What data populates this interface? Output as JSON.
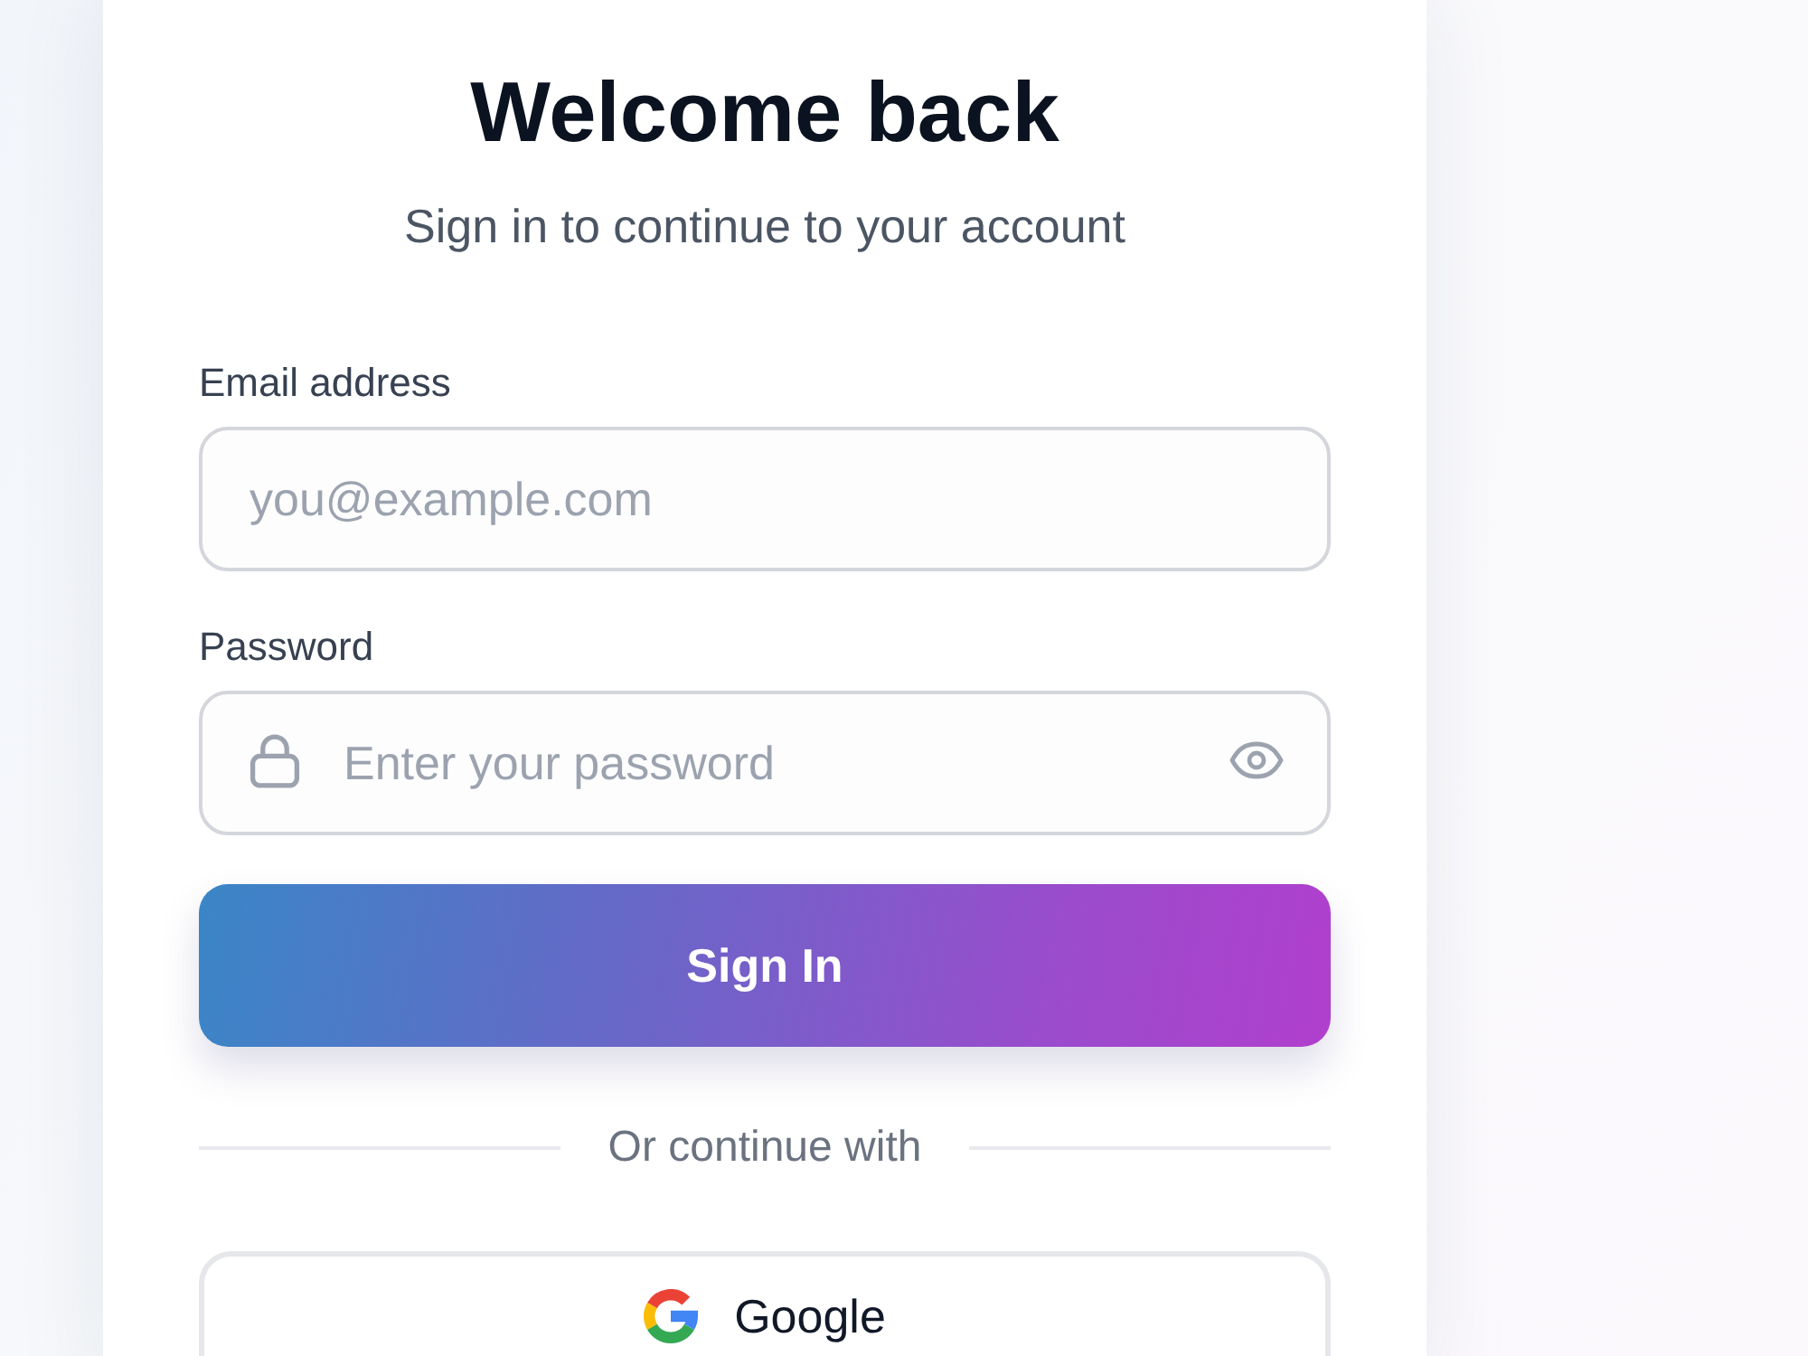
{
  "heading": {
    "title": "Welcome back",
    "subtitle": "Sign in to continue to your account"
  },
  "fields": [
    {
      "kind": "email",
      "label": "Email address",
      "placeholder": "you@example.com"
    },
    {
      "kind": "password",
      "label": "Password",
      "placeholder": "Enter your password"
    }
  ],
  "submit": {
    "label": "Sign In"
  },
  "divider": {
    "text": "Or continue with"
  },
  "providers": [
    {
      "kind": "google",
      "label": "Google"
    }
  ]
}
